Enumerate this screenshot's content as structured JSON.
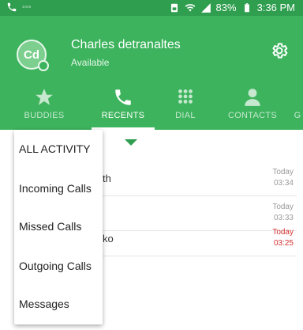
{
  "status_bar": {
    "battery_percent": "83%",
    "time": "3:36 PM"
  },
  "user": {
    "initials": "Cd",
    "name": "Charles detranaltes",
    "status": "Available"
  },
  "tabs": [
    {
      "label": "BUDDIES",
      "icon": "star-icon",
      "active": false
    },
    {
      "label": "RECENTS",
      "icon": "phone-icon",
      "active": true
    },
    {
      "label": "DIAL",
      "icon": "dialpad-icon",
      "active": false
    },
    {
      "label": "CONTACTS",
      "icon": "person-icon",
      "active": false
    },
    {
      "label": "G",
      "icon": "",
      "active": false
    }
  ],
  "recents": [
    {
      "name": "th",
      "day": "Today",
      "time": "03:34",
      "missed": false
    },
    {
      "name": "",
      "day": "Today",
      "time": "03:33",
      "missed": false
    },
    {
      "name": "ko",
      "day": "Today",
      "time": "03:25",
      "missed": true
    }
  ],
  "menu": {
    "items": [
      "ALL ACTIVITY",
      "Incoming Calls",
      "Missed Calls",
      "Outgoing Calls",
      "Messages"
    ]
  },
  "colors": {
    "status_bar": "#2f9e4f",
    "header": "#3cb35c",
    "missed": "#d32f2f"
  }
}
